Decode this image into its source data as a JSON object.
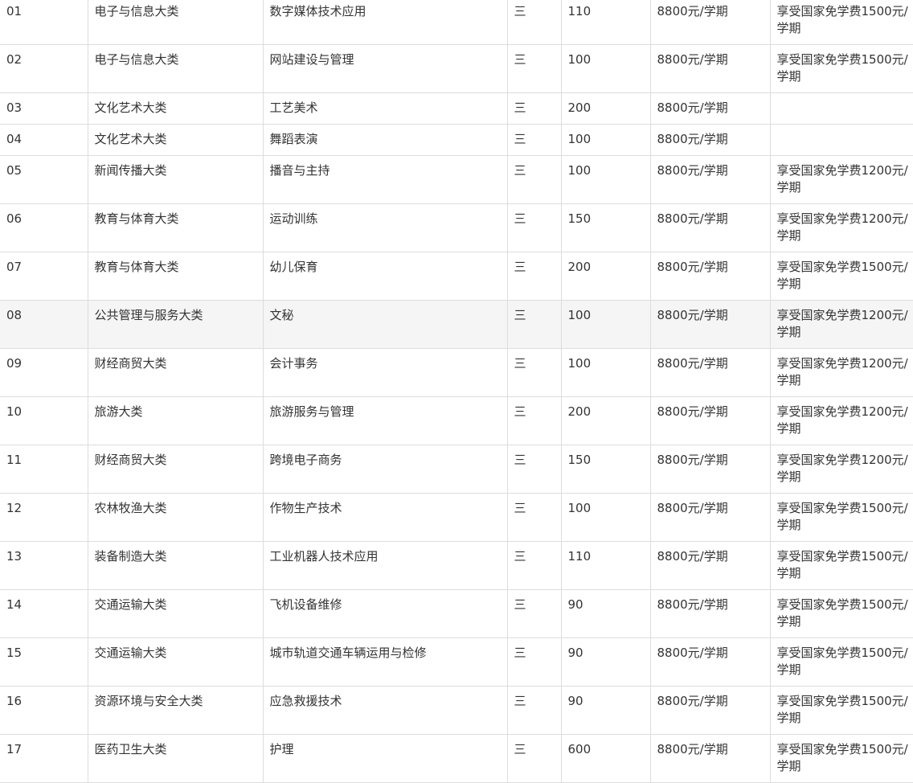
{
  "table": {
    "rows": [
      {
        "no": "01",
        "category": "电子与信息大类",
        "major": "数字媒体技术应用",
        "years": "三",
        "plan": "110",
        "fee": "8800元/学期",
        "note": "享受国家免学费1500元/学期"
      },
      {
        "no": "02",
        "category": "电子与信息大类",
        "major": "网站建设与管理",
        "years": "三",
        "plan": "100",
        "fee": "8800元/学期",
        "note": "享受国家免学费1500元/学期"
      },
      {
        "no": "03",
        "category": "文化艺术大类",
        "major": "工艺美术",
        "years": "三",
        "plan": "200",
        "fee": "8800元/学期",
        "note": ""
      },
      {
        "no": "04",
        "category": "文化艺术大类",
        "major": "舞蹈表演",
        "years": "三",
        "plan": "100",
        "fee": "8800元/学期",
        "note": ""
      },
      {
        "no": "05",
        "category": "新闻传播大类",
        "major": "播音与主持",
        "years": "三",
        "plan": "100",
        "fee": "8800元/学期",
        "note": "享受国家免学费1200元/学期"
      },
      {
        "no": "06",
        "category": "教育与体育大类",
        "major": "运动训练",
        "years": "三",
        "plan": "150",
        "fee": "8800元/学期",
        "note": "享受国家免学费1200元/学期"
      },
      {
        "no": "07",
        "category": "教育与体育大类",
        "major": "幼儿保育",
        "years": "三",
        "plan": "200",
        "fee": "8800元/学期",
        "note": "享受国家免学费1500元/学期"
      },
      {
        "no": "08",
        "category": "公共管理与服务大类",
        "major": "文秘",
        "years": "三",
        "plan": "100",
        "fee": "8800元/学期",
        "note": "享受国家免学费1200元/学期"
      },
      {
        "no": "09",
        "category": "财经商贸大类",
        "major": "会计事务",
        "years": "三",
        "plan": "100",
        "fee": "8800元/学期",
        "note": "享受国家免学费1200元/学期"
      },
      {
        "no": "10",
        "category": "旅游大类",
        "major": "旅游服务与管理",
        "years": "三",
        "plan": "200",
        "fee": "8800元/学期",
        "note": "享受国家免学费1200元/学期"
      },
      {
        "no": "11",
        "category": "财经商贸大类",
        "major": "跨境电子商务",
        "years": "三",
        "plan": "150",
        "fee": "8800元/学期",
        "note": "享受国家免学费1200元/学期"
      },
      {
        "no": "12",
        "category": "农林牧渔大类",
        "major": "作物生产技术",
        "years": "三",
        "plan": "100",
        "fee": "8800元/学期",
        "note": "享受国家免学费1500元/学期"
      },
      {
        "no": "13",
        "category": "装备制造大类",
        "major": "工业机器人技术应用",
        "years": "三",
        "plan": "110",
        "fee": "8800元/学期",
        "note": "享受国家免学费1500元/学期"
      },
      {
        "no": "14",
        "category": "交通运输大类",
        "major": "飞机设备维修",
        "years": "三",
        "plan": "90",
        "fee": "8800元/学期",
        "note": "享受国家免学费1500元/学期"
      },
      {
        "no": "15",
        "category": "交通运输大类",
        "major": "城市轨道交通车辆运用与检修",
        "years": "三",
        "plan": "90",
        "fee": "8800元/学期",
        "note": "享受国家免学费1500元/学期"
      },
      {
        "no": "16",
        "category": "资源环境与安全大类",
        "major": "应急救援技术",
        "years": "三",
        "plan": "90",
        "fee": "8800元/学期",
        "note": "享受国家免学费1500元/学期"
      },
      {
        "no": "17",
        "category": "医药卫生大类",
        "major": "护理",
        "years": "三",
        "plan": "600",
        "fee": "8800元/学期",
        "note": "享受国家免学费1500元/学期"
      }
    ]
  }
}
